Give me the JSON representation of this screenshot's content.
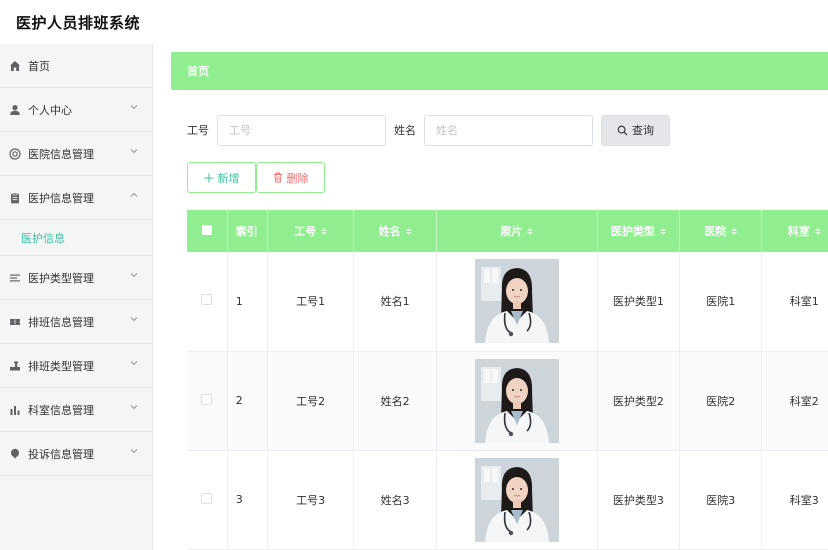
{
  "app": {
    "title": "医护人员排班系统"
  },
  "sidebar": {
    "items": [
      {
        "label": "首页",
        "icon": "home-icon",
        "has_arrow": false
      },
      {
        "label": "个人中心",
        "icon": "user-icon",
        "has_arrow": true,
        "expanded": false
      },
      {
        "label": "医院信息管理",
        "icon": "lifebuoy-icon",
        "has_arrow": true,
        "expanded": false
      },
      {
        "label": "医护信息管理",
        "icon": "clipboard-icon",
        "has_arrow": true,
        "expanded": true
      },
      {
        "label": "医护类型管理",
        "icon": "list-icon",
        "has_arrow": true,
        "expanded": false
      },
      {
        "label": "排班信息管理",
        "icon": "ticket-icon",
        "has_arrow": true,
        "expanded": false
      },
      {
        "label": "排班类型管理",
        "icon": "stamp-icon",
        "has_arrow": true,
        "expanded": false
      },
      {
        "label": "科室信息管理",
        "icon": "bar-chart-icon",
        "has_arrow": true,
        "expanded": false
      },
      {
        "label": "投诉信息管理",
        "icon": "balloon-icon",
        "has_arrow": true,
        "expanded": false
      }
    ],
    "sub_item": "医护信息"
  },
  "breadcrumb": {
    "label": "首页"
  },
  "search": {
    "job_no_label": "工号",
    "job_no_placeholder": "工号",
    "job_no_value": "",
    "name_label": "姓名",
    "name_placeholder": "姓名",
    "name_value": "",
    "query_label": "查询"
  },
  "actions": {
    "add_label": "新增",
    "delete_label": "删除"
  },
  "colors": {
    "accent": "#90ee90",
    "sub_active": "#3cc3a0",
    "danger": "#f56c6c"
  },
  "table": {
    "columns": [
      "索引",
      "工号",
      "姓名",
      "照片",
      "医护类型",
      "医院",
      "科室"
    ],
    "rows": [
      {
        "index": "1",
        "job_no": "工号1",
        "name": "姓名1",
        "type": "医护类型1",
        "hospital": "医院1",
        "dept": "科室1"
      },
      {
        "index": "2",
        "job_no": "工号2",
        "name": "姓名2",
        "type": "医护类型2",
        "hospital": "医院2",
        "dept": "科室2"
      },
      {
        "index": "3",
        "job_no": "工号3",
        "name": "姓名3",
        "type": "医护类型3",
        "hospital": "医院3",
        "dept": "科室3"
      }
    ]
  }
}
